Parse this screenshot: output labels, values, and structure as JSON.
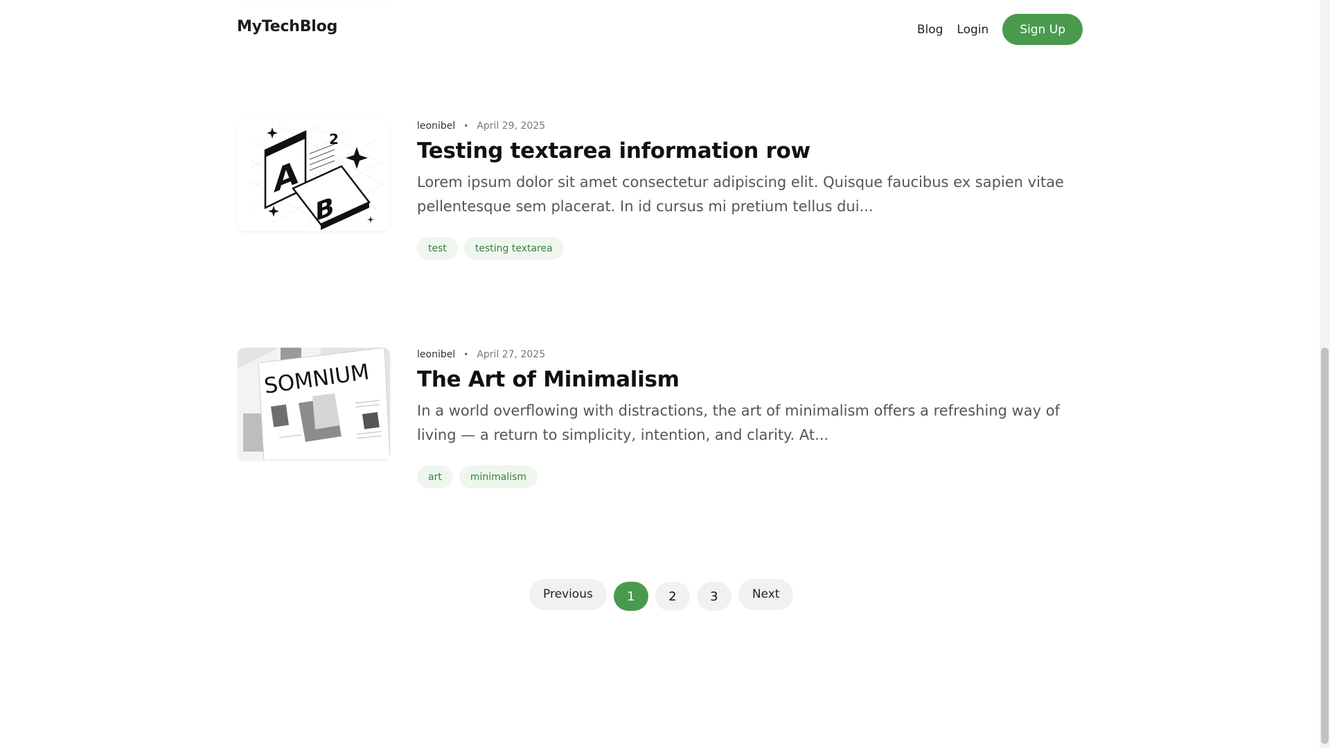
{
  "header": {
    "brand": "MyTechBlog",
    "nav": [
      "Blog",
      "Login"
    ],
    "signup_label": "Sign Up"
  },
  "posts": [
    {
      "author": "leonibel",
      "date": "April 29, 2025",
      "title": "Testing textarea information row",
      "excerpt": "Lorem ipsum dolor sit amet consectetur adipiscing elit. Quisque faucibus ex sapien vitae pellentesque sem placerat. In id cursus mi pretium tellus dui...",
      "tags": [
        "test",
        "testing textarea"
      ],
      "thumbnail_icon": "ab-isometric-illustration"
    },
    {
      "author": "leonibel",
      "date": "April 27, 2025",
      "title": "The Art of Minimalism",
      "excerpt": "In a world overflowing with distractions, the art of minimalism offers a refreshing way of living — a return to simplicity, intention, and clarity. At...",
      "tags": [
        "art",
        "minimalism"
      ],
      "thumbnail_icon": "somnium-magazine-mockup",
      "thumbnail_text": "SOMNIUM"
    }
  ],
  "pagination": {
    "previous_label": "Previous",
    "pages": [
      "1",
      "2",
      "3"
    ],
    "current": "1",
    "next_label": "Next"
  },
  "colors": {
    "accent": "#4a9a4e",
    "tag_bg": "#eef6ee",
    "tag_text": "#3d7d41"
  }
}
